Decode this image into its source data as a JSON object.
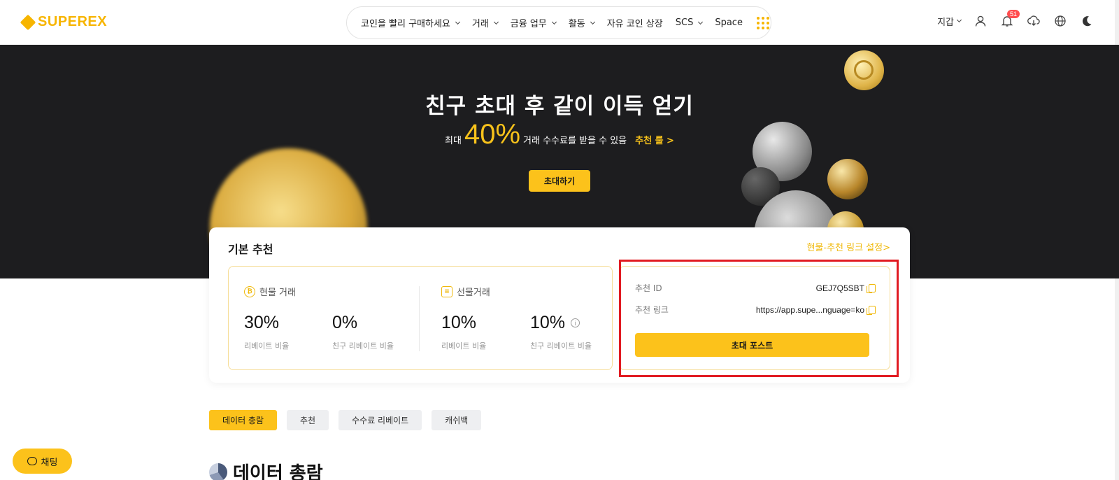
{
  "header": {
    "logo": "SUPEREX",
    "nav": [
      {
        "label": "코인을 빨리 구매하세요",
        "has_dropdown": true
      },
      {
        "label": "거래",
        "has_dropdown": true
      },
      {
        "label": "금융 업무",
        "has_dropdown": true
      },
      {
        "label": "활동",
        "has_dropdown": true
      },
      {
        "label": "자유 코인 상장",
        "has_dropdown": false
      },
      {
        "label": "SCS",
        "has_dropdown": true
      },
      {
        "label": "Space",
        "has_dropdown": false
      }
    ],
    "wallet_label": "지갑",
    "notification_count": "51",
    "icons": [
      "user-icon",
      "bell-icon",
      "download-icon",
      "globe-icon",
      "moon-icon"
    ]
  },
  "banner": {
    "title": "친구 초대 후 같이 이득 얻기",
    "sub_prefix": "최대",
    "sub_percent": "40%",
    "sub_suffix": "거래 수수료를 받을 수 있음",
    "rule_link": "추천 룰 >",
    "invite_button": "초대하기"
  },
  "card": {
    "title": "기본 추천",
    "settings_link": "현물-추천 링크 설정>",
    "spot": {
      "title": "현물 거래",
      "rebate": "30%",
      "rebate_label": "리베이트 비율",
      "friend_rebate": "0%",
      "friend_rebate_label": "친구 리베이트 비율"
    },
    "futures": {
      "title": "선물거래",
      "rebate": "10%",
      "rebate_label": "리베이트 비율",
      "friend_rebate": "10%",
      "friend_rebate_label": "친구 리베이트 비율"
    },
    "referral": {
      "id_label": "추천 ID",
      "id_value": "GEJ7Q5SBT",
      "link_label": "추천 링크",
      "link_value": "https://app.supe...nguage=ko",
      "post_button": "초대 포스트"
    }
  },
  "tabs": [
    {
      "label": "데이터 총람",
      "active": true
    },
    {
      "label": "추천",
      "active": false
    },
    {
      "label": "수수료 리베이트",
      "active": false
    },
    {
      "label": "캐쉬백",
      "active": false
    }
  ],
  "section_title": "데이터 총람",
  "chat_button": "채팅",
  "colors": {
    "accent": "#fcc21b",
    "brand": "#f7b500",
    "banner_bg": "#1d1d1f",
    "highlight_frame": "#e11b22"
  }
}
